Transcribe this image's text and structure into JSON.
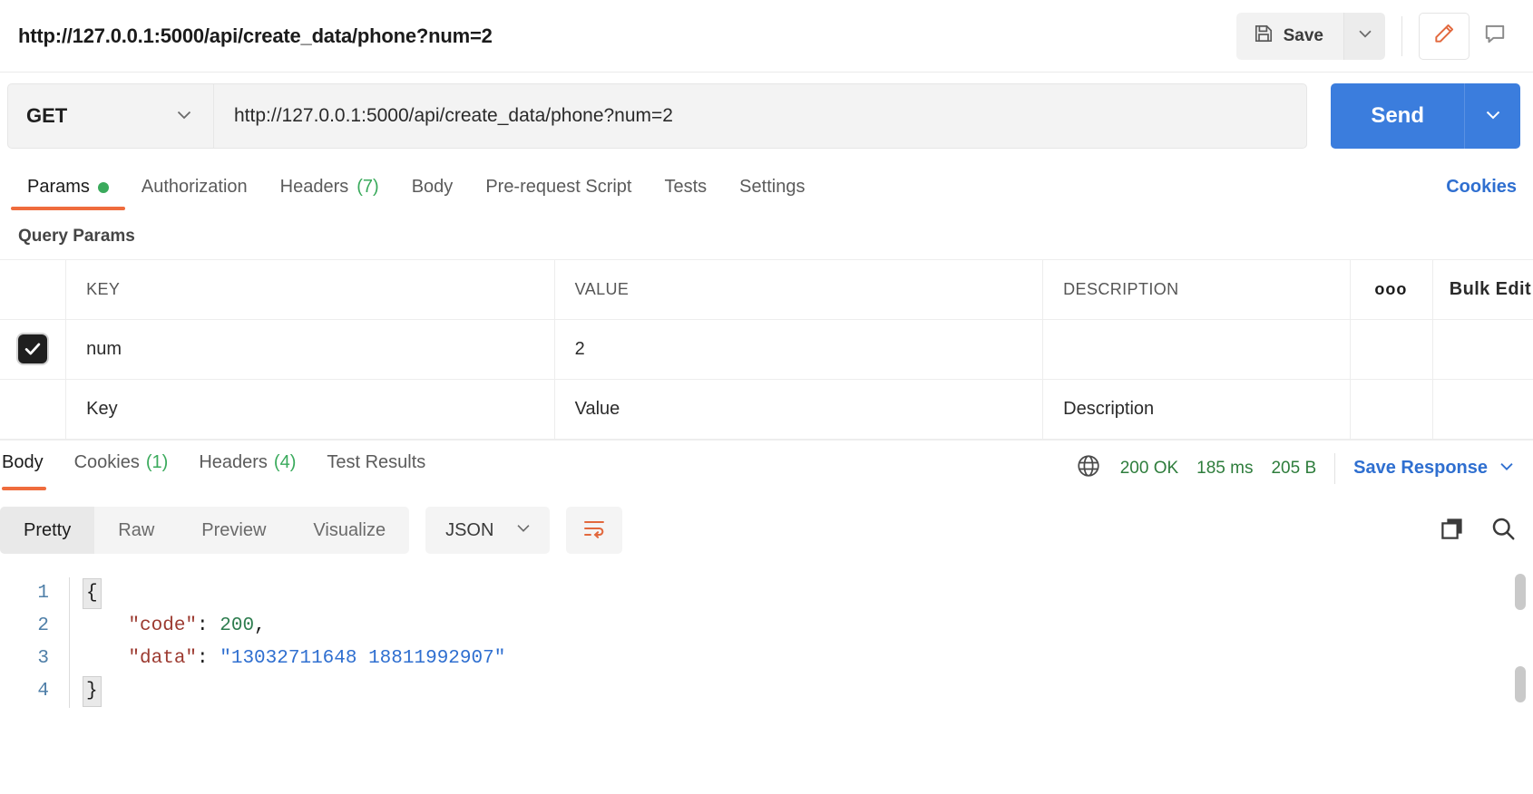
{
  "request_name": "http://127.0.0.1:5000/api/create_data/phone?num=2",
  "toolbar": {
    "save_label": "Save",
    "save_icon": "floppy-disk-icon",
    "save_caret_icon": "chevron-down-icon",
    "edit_icon": "pencil-icon",
    "comment_icon": "comment-icon",
    "accent_orange": "#ef6c3d"
  },
  "url_bar": {
    "method": "GET",
    "method_caret_icon": "chevron-down-icon",
    "url": "http://127.0.0.1:5000/api/create_data/phone?num=2",
    "send_label": "Send",
    "send_caret_icon": "chevron-down-icon",
    "send_color": "#3b7ddd"
  },
  "request_tabs": {
    "items": [
      {
        "label": "Params",
        "badge": "",
        "dot": true,
        "active": true
      },
      {
        "label": "Authorization",
        "badge": "",
        "dot": false,
        "active": false
      },
      {
        "label": "Headers",
        "badge": "(7)",
        "dot": false,
        "active": false
      },
      {
        "label": "Body",
        "badge": "",
        "dot": false,
        "active": false
      },
      {
        "label": "Pre-request Script",
        "badge": "",
        "dot": false,
        "active": false
      },
      {
        "label": "Tests",
        "badge": "",
        "dot": false,
        "active": false
      },
      {
        "label": "Settings",
        "badge": "",
        "dot": false,
        "active": false
      }
    ],
    "cookies_link": "Cookies"
  },
  "query_params": {
    "title": "Query Params",
    "headers": {
      "key": "KEY",
      "value": "VALUE",
      "description": "DESCRIPTION",
      "more_icon": "ooo",
      "bulk_edit": "Bulk Edit"
    },
    "rows": [
      {
        "checked": true,
        "key": "num",
        "value": "2",
        "description": ""
      }
    ],
    "placeholder_row": {
      "key": "Key",
      "value": "Value",
      "description": "Description"
    }
  },
  "response": {
    "tabs": [
      {
        "label": "Body",
        "badge": "",
        "active": true
      },
      {
        "label": "Cookies",
        "badge": "(1)",
        "active": false
      },
      {
        "label": "Headers",
        "badge": "(4)",
        "active": false
      },
      {
        "label": "Test Results",
        "badge": "",
        "active": false
      }
    ],
    "globe_icon": "globe-icon",
    "status": "200 OK",
    "time": "185 ms",
    "size": "205 B",
    "status_color": "#2e7d3c",
    "save_response_label": "Save Response",
    "save_response_caret_icon": "chevron-down-icon",
    "viewer": {
      "modes": [
        {
          "label": "Pretty",
          "active": true
        },
        {
          "label": "Raw",
          "active": false
        },
        {
          "label": "Preview",
          "active": false
        },
        {
          "label": "Visualize",
          "active": false
        }
      ],
      "format": "JSON",
      "format_caret_icon": "chevron-down-icon",
      "wrap_icon": "word-wrap-icon",
      "copy_icon": "copy-icon",
      "search_icon": "search-icon"
    },
    "body_lines": [
      {
        "n": "1",
        "tokens": [
          {
            "t": "brace",
            "v": "{"
          }
        ]
      },
      {
        "n": "2",
        "tokens": [
          {
            "t": "key",
            "v": "    \"code\""
          },
          {
            "t": "punct",
            "v": ": "
          },
          {
            "t": "num",
            "v": "200"
          },
          {
            "t": "punct",
            "v": ","
          }
        ]
      },
      {
        "n": "3",
        "tokens": [
          {
            "t": "key",
            "v": "    \"data\""
          },
          {
            "t": "punct",
            "v": ": "
          },
          {
            "t": "str",
            "v": "\"13032711648 18811992907\""
          }
        ]
      },
      {
        "n": "4",
        "tokens": [
          {
            "t": "brace",
            "v": "}"
          }
        ]
      }
    ]
  }
}
